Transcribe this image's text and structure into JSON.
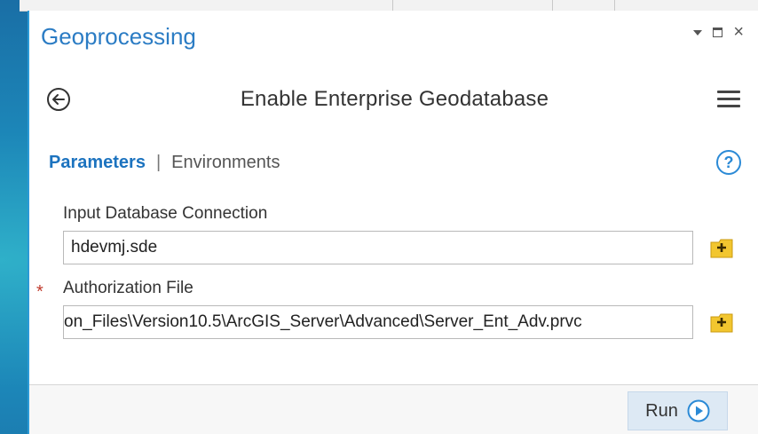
{
  "pane": {
    "title": "Geoprocessing",
    "controls": {
      "dropdown_icon": "dropdown-arrow-icon",
      "maximize_icon": "maximize-icon",
      "close_glyph": "×"
    }
  },
  "tool": {
    "title": "Enable Enterprise Geodatabase",
    "back_icon": "back-arrow-icon",
    "menu_icon": "hamburger-menu-icon"
  },
  "tabs": {
    "parameters": "Parameters",
    "separator": "|",
    "environments": "Environments",
    "help_icon": "help-icon"
  },
  "params": {
    "input_connection": {
      "label": "Input Database Connection",
      "value": "hdevmj.sde",
      "required": false
    },
    "authorization_file": {
      "label": "Authorization File",
      "value": "on_Files\\Version10.5\\ArcGIS_Server\\Advanced\\Server_Ent_Adv.prvc",
      "required": true,
      "required_marker": "*"
    }
  },
  "footer": {
    "run_label": "Run",
    "run_icon": "play-icon"
  },
  "colors": {
    "accent": "#2b7cc4",
    "tab_active": "#1c73bf",
    "required": "#c0392b",
    "run_bg": "#dde9f4",
    "folder": "#f2c62f"
  }
}
